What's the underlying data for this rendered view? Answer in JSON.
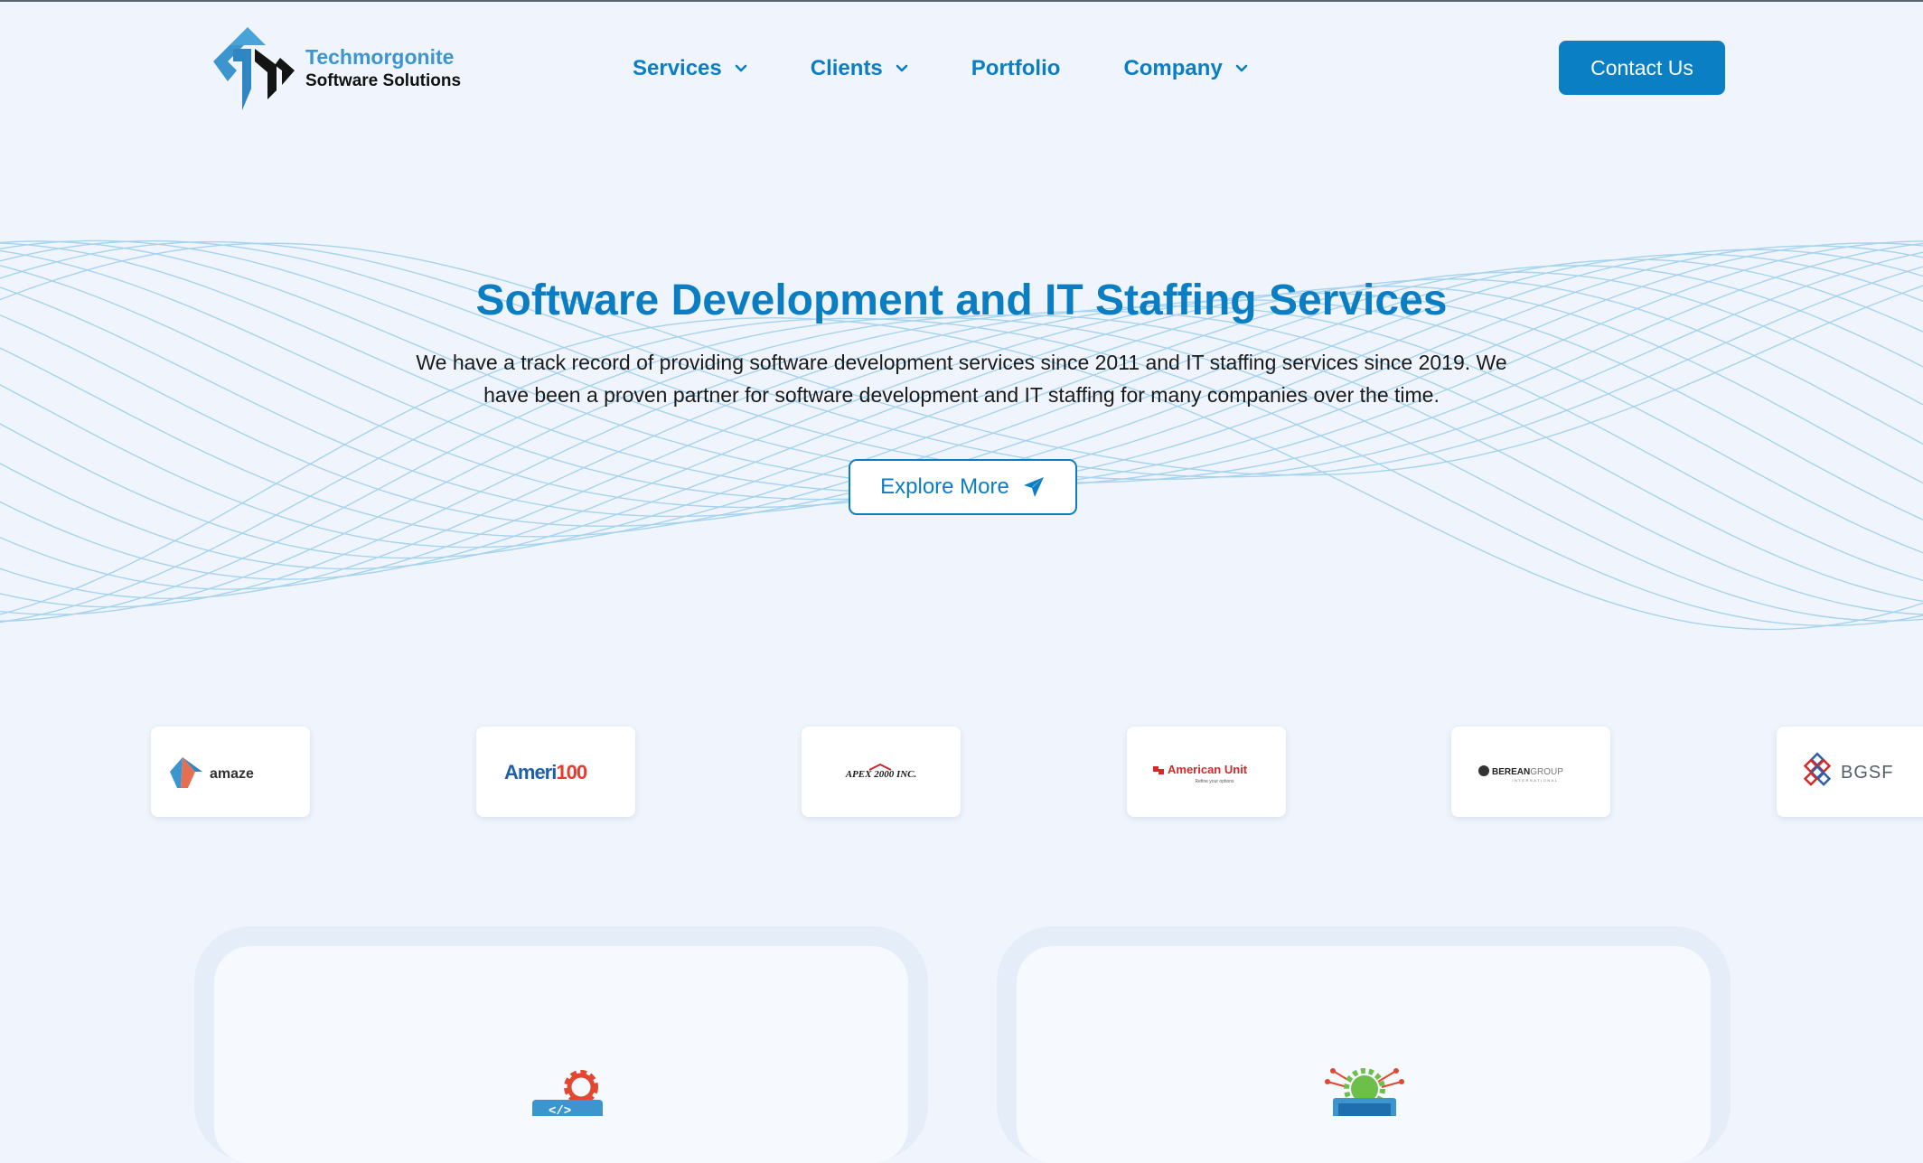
{
  "brand": {
    "name_line1": "Techmorgonite",
    "name_line2": "Software Solutions",
    "colors": {
      "primary": "#0b7ec3",
      "logo_blue": "#3d95cf",
      "background": "#f0f5fd"
    }
  },
  "nav": {
    "items": [
      {
        "label": "Services",
        "has_dropdown": true,
        "icon": "chevron-down-icon"
      },
      {
        "label": "Clients",
        "has_dropdown": true,
        "icon": "chevron-down-icon"
      },
      {
        "label": "Portfolio",
        "has_dropdown": false
      },
      {
        "label": "Company",
        "has_dropdown": true,
        "icon": "chevron-down-icon"
      }
    ],
    "contact_label": "Contact Us"
  },
  "hero": {
    "title": "Software Development and IT Staffing Services",
    "description": "We have a track record of providing software development services since 2011 and IT staffing services since 2019. We have been a proven partner for software development and IT staffing for many companies over the time.",
    "cta_label": "Explore More",
    "cta_icon": "paper-plane-icon"
  },
  "clients": [
    {
      "name": "amaze"
    },
    {
      "name": "Ameri100",
      "part1": "Ameri",
      "part2": "100"
    },
    {
      "name": "APEX 2000 INC."
    },
    {
      "name": "American Unit",
      "tagline": "Refine your options"
    },
    {
      "name": "BEREAN GROUP",
      "part1": "BEREAN",
      "part2": "GROUP",
      "tagline": "INTERNATIONAL"
    },
    {
      "name": "BGSF"
    }
  ],
  "features": [
    {
      "icon": "code-gear-icon"
    },
    {
      "icon": "monitor-network-gear-icon"
    }
  ]
}
